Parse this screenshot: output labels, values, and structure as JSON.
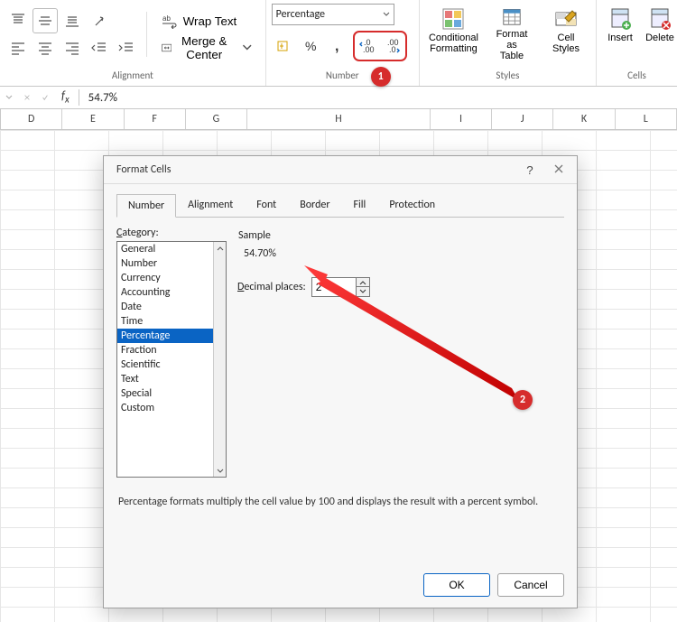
{
  "ribbon": {
    "alignment": {
      "label": "Alignment",
      "wrap": "Wrap Text",
      "merge": "Merge & Center"
    },
    "number": {
      "label": "Number",
      "format_selector": "Percentage"
    },
    "styles": {
      "label": "Styles",
      "cond": "Conditional\nFormatting",
      "table": "Format as\nTable",
      "cell": "Cell\nStyles"
    },
    "cells": {
      "label": "Cells",
      "insert": "Insert",
      "delete": "Delete"
    }
  },
  "formula_bar": {
    "value": "54.7%"
  },
  "columns": [
    "D",
    "E",
    "F",
    "G",
    "H",
    "I",
    "J",
    "K",
    "L"
  ],
  "annotations": {
    "badge1": "1",
    "badge2": "2"
  },
  "dialog": {
    "title": "Format Cells",
    "tabs": [
      "Number",
      "Alignment",
      "Font",
      "Border",
      "Fill",
      "Protection"
    ],
    "active_tab": 0,
    "category_label": "Category:",
    "categories": [
      "General",
      "Number",
      "Currency",
      "Accounting",
      "Date",
      "Time",
      "Percentage",
      "Fraction",
      "Scientific",
      "Text",
      "Special",
      "Custom"
    ],
    "selected_category": 6,
    "sample_label": "Sample",
    "sample_value": "54.70%",
    "decimal_label": "Decimal places:",
    "decimal_value": "2",
    "description": "Percentage formats multiply the cell value by 100 and displays the result with a percent symbol.",
    "ok": "OK",
    "cancel": "Cancel"
  }
}
